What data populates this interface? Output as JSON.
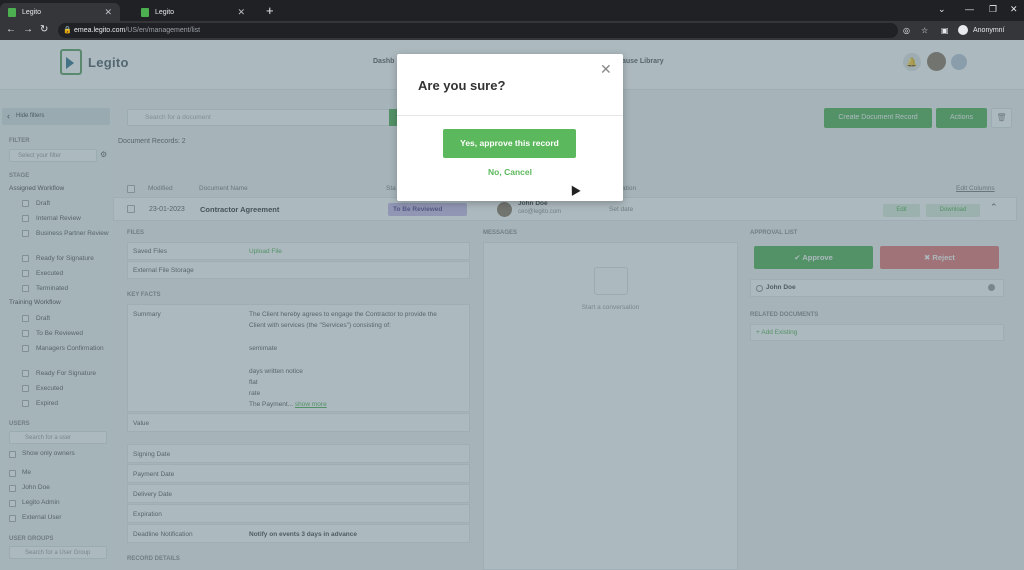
{
  "browser": {
    "tabs": [
      {
        "title": "Legito"
      },
      {
        "title": "Legito"
      }
    ],
    "url_host": "emea.legito.com",
    "url_path": "/US/en/management/list",
    "profile": "Anonymní"
  },
  "header": {
    "brand": "Legito",
    "nav_left": "Dashb",
    "nav_right": "ause Library"
  },
  "sidebar": {
    "hide_filters": "Hide filters",
    "filter_label": "FILTER",
    "filter_placeholder": "Select your filter",
    "stage_label": "STAGE",
    "assigned_title": "Assigned Workflow",
    "assigned_items": [
      "Draft",
      "Internal Review",
      "Business Partner Review",
      "Ready for Signature",
      "Executed",
      "Terminated"
    ],
    "training_title": "Training Workflow",
    "training_items": [
      "Draft",
      "To Be Reviewed",
      "Managers Confirmation",
      "Ready For Signature",
      "Executed",
      "Expired"
    ],
    "users_label": "USERS",
    "user_search_placeholder": "Search for a user",
    "show_only_owners": "Show only owners",
    "users": [
      "Me",
      "John Doe",
      "Legito Admin",
      "External User"
    ],
    "user_groups_label": "USER GROUPS",
    "user_group_search_placeholder": "Search for a User Group"
  },
  "main": {
    "search_placeholder": "Search for a document",
    "doc_count": "Document Records: 2",
    "btn_create": "Create Document Record",
    "btn_actions": "Actions",
    "columns": {
      "modified": "Modified",
      "doc_name": "Document Name",
      "stage_prefix": "Sta",
      "expiration_suffix": "ation",
      "edit_columns": "Edit Columns"
    },
    "row": {
      "date": "23-01-2023",
      "name": "Contractor Agreement",
      "stage": "To Be Reviewed",
      "owner_name": "John Doe",
      "owner_email": "ceo@legito.com",
      "set_date": "Set date",
      "edit": "Edit",
      "download": "Download"
    },
    "files": {
      "title": "FILES",
      "saved_files": "Saved Files",
      "upload": "Upload File",
      "external": "External File Storage"
    },
    "key_facts": {
      "title": "KEY FACTS",
      "summary_label": "Summary",
      "summary_lines": [
        "The Client hereby agrees to engage the Contractor to provide the",
        "Client with services (the \"Services\") consisting of:",
        "",
        "semimate",
        "",
        "days written notice",
        "flat",
        "rate"
      ],
      "summary_tail": "The Payment...",
      "show_more": "show more",
      "value_label": "Value",
      "signing_date": "Signing Date",
      "payment_date": "Payment Date",
      "delivery_date": "Delivery Date",
      "expiration": "Expiration",
      "deadline_label": "Deadline Notification",
      "deadline_value": "Notify on events 3 days in advance"
    },
    "record_details": "RECORD DETAILS",
    "messages": {
      "title": "MESSAGES",
      "start": "Start a conversation"
    },
    "approval": {
      "title": "APPROVAL LIST",
      "approve": "Approve",
      "reject": "Reject",
      "approver": "John Doe"
    },
    "related": {
      "title": "RELATED DOCUMENTS",
      "add_existing": "Add Existing"
    }
  },
  "modal": {
    "title": "Are you sure?",
    "confirm": "Yes, approve this record",
    "cancel": "No, Cancel"
  }
}
